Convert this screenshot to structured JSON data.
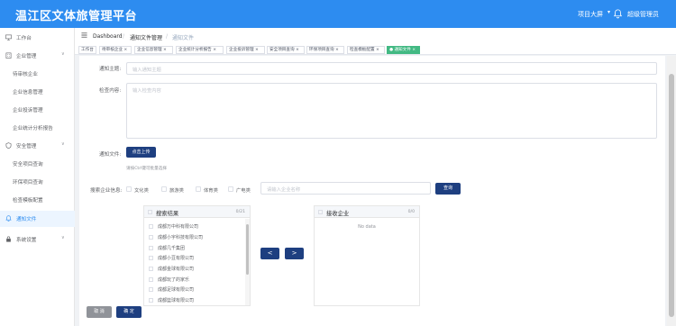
{
  "header": {
    "title": "温江区文体旅管理平台",
    "screen_label": "项目大屏",
    "user_label": "超级管理员",
    "accent": "#2d8cf0"
  },
  "sidebar": {
    "items": [
      {
        "label": "工作台",
        "icon": "monitor-icon"
      },
      {
        "label": "企业管理",
        "icon": "building-icon"
      },
      {
        "label": "待审核企业"
      },
      {
        "label": "企业信息管理"
      },
      {
        "label": "企业投诉管理"
      },
      {
        "label": "企业统计分析报告"
      },
      {
        "label": "安全管理",
        "icon": "shield-icon"
      },
      {
        "label": "安全项目查询"
      },
      {
        "label": "环保项目查询"
      },
      {
        "label": "检查模板配置"
      },
      {
        "label": "通知文件",
        "icon": "bell-icon"
      },
      {
        "label": "系统设置",
        "icon": "lock-icon"
      }
    ]
  },
  "breadcrumb": {
    "home": "Dashboard",
    "sep": "/",
    "level1": "通知文件管理",
    "level2": "通知文件"
  },
  "tags": [
    {
      "label": "工作台"
    },
    {
      "label": "待审核企业 ×"
    },
    {
      "label": "企业信息管理 ×"
    },
    {
      "label": "企业统计分析报告 ×"
    },
    {
      "label": "企业投诉管理 ×"
    },
    {
      "label": "安全项目查询 ×"
    },
    {
      "label": "环保项目查询 ×"
    },
    {
      "label": "检查模板配置 ×"
    },
    {
      "label": "● 通知文件 ×"
    }
  ],
  "form": {
    "subject_label": "通知主题:",
    "subject_placeholder": "输入通知主题",
    "content_label": "检查内容:",
    "content_placeholder": "输入检查内容",
    "file_label": "通知文件:",
    "upload_label": "点击上传",
    "upload_tip": "请按Ctrl键可批量选择",
    "search_label": "搜索企业信息:",
    "categories": [
      "文化类",
      "旅游类",
      "体育类",
      "广电类"
    ],
    "search_placeholder": "请输入企业名称",
    "search_button": "查询"
  },
  "transfer": {
    "left": {
      "title": "搜索结果",
      "count": "0/21",
      "items": [
        "成都万中科有限公司",
        "成都小宇科技有限公司",
        "成都几千集团",
        "成都小豆有限公司",
        "成都金球有限公司",
        "成都玩了的家乐",
        "成都足球有限公司",
        "成都篮球有限公司"
      ]
    },
    "right": {
      "title": "接收企业",
      "count": "0/0",
      "empty": "No data"
    },
    "to_left": "<",
    "to_right": ">"
  },
  "actions": {
    "cancel": "取 消",
    "confirm": "确 定"
  }
}
